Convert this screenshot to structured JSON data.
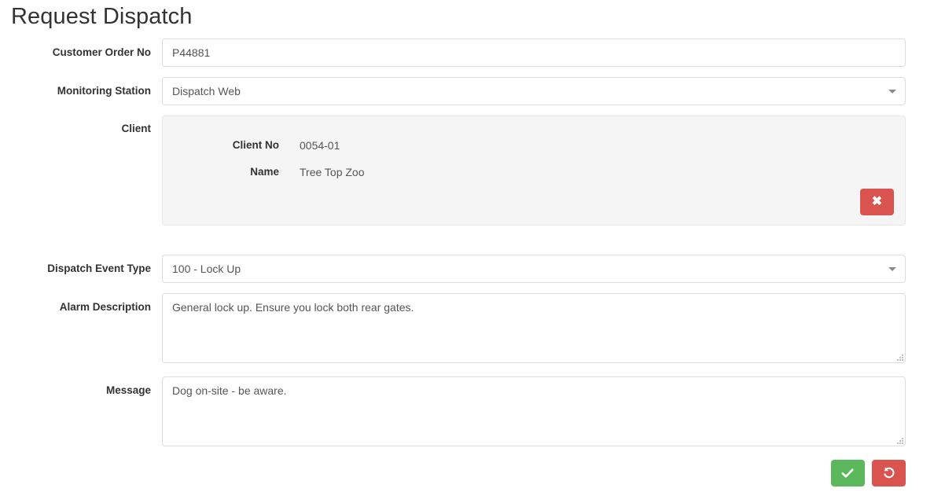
{
  "page": {
    "title": "Request Dispatch"
  },
  "form": {
    "customer_order_no": {
      "label": "Customer Order No",
      "value": "P44881",
      "placeholder": ""
    },
    "monitoring_station": {
      "label": "Monitoring Station",
      "value": "Dispatch Web",
      "caret_icon": "chevron-down-icon"
    },
    "client": {
      "label": "Client",
      "fields": [
        {
          "label": "Client No",
          "value": "0054-01"
        },
        {
          "label": "Name",
          "value": "Tree Top Zoo"
        }
      ],
      "clear_button": {
        "icon": "close-icon",
        "glyph": "✖",
        "color": "#d9534f"
      }
    },
    "dispatch_event_type": {
      "label": "Dispatch Event Type",
      "value": "100 - Lock Up",
      "caret_icon": "chevron-down-icon"
    },
    "alarm_description": {
      "label": "Alarm Description",
      "value": "General lock up. Ensure you lock both rear gates.",
      "placeholder": ""
    },
    "message": {
      "label": "Message",
      "value": "Dog on-site - be aware.",
      "placeholder": ""
    }
  },
  "actions": {
    "submit": {
      "icon": "check-icon",
      "color": "#5cb85c"
    },
    "reset": {
      "icon": "undo-icon",
      "color": "#d9534f"
    }
  }
}
